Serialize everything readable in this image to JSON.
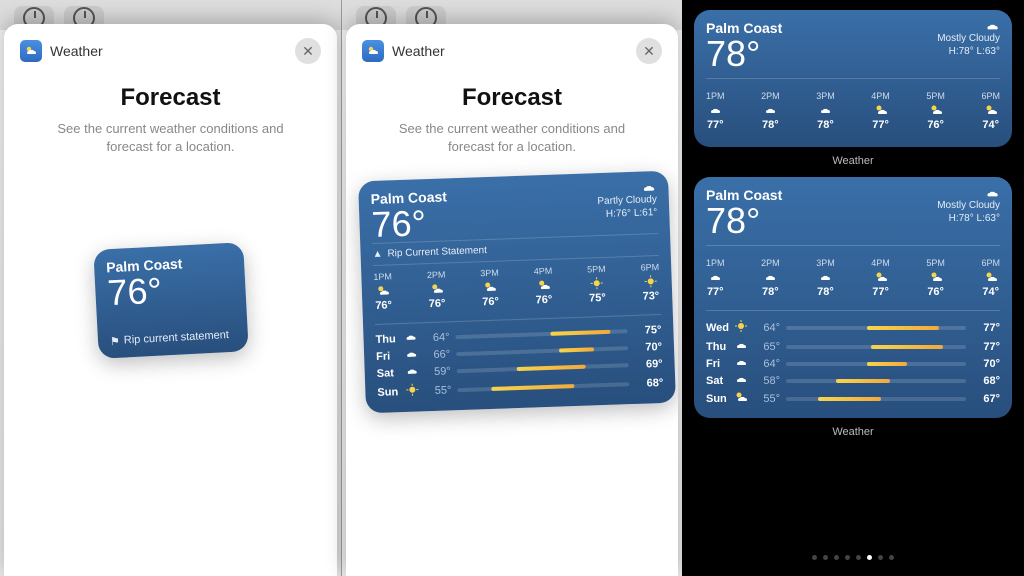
{
  "panels": {
    "p1": {
      "app_name": "Weather",
      "title": "Forecast",
      "subtitle": "See the current weather conditions and forecast for a location.",
      "widget": {
        "city": "Palm Coast",
        "temp": "76°",
        "alert_icon": "⚑",
        "alert": "Rip current statement"
      }
    },
    "p2": {
      "app_name": "Weather",
      "title": "Forecast",
      "subtitle": "See the current weather conditions and forecast for a location.",
      "widget": {
        "city": "Palm Coast",
        "temp": "76°",
        "cond": "Partly Cloudy",
        "hilo": "H:76° L:61°",
        "alert": "Rip Current Statement",
        "hourly": [
          {
            "t": "1PM",
            "icon": "pc",
            "v": "76°"
          },
          {
            "t": "2PM",
            "icon": "pc",
            "v": "76°"
          },
          {
            "t": "3PM",
            "icon": "pc",
            "v": "76°"
          },
          {
            "t": "4PM",
            "icon": "pc",
            "v": "76°"
          },
          {
            "t": "5PM",
            "icon": "sun",
            "v": "75°"
          },
          {
            "t": "6PM",
            "icon": "sun",
            "v": "73°"
          }
        ],
        "daily": [
          {
            "d": "Thu",
            "icon": "cloud",
            "lo": "64°",
            "hi": "75°",
            "bs": 55,
            "bw": 35
          },
          {
            "d": "Fri",
            "icon": "cloud",
            "lo": "66°",
            "hi": "70°",
            "bs": 60,
            "bw": 20
          },
          {
            "d": "Sat",
            "icon": "cloud",
            "lo": "59°",
            "hi": "69°",
            "bs": 35,
            "bw": 40
          },
          {
            "d": "Sun",
            "icon": "sun",
            "lo": "55°",
            "hi": "68°",
            "bs": 20,
            "bw": 48
          }
        ]
      }
    },
    "p3": {
      "caption": "Weather",
      "widget_med": {
        "city": "Palm Coast",
        "temp": "78°",
        "cond": "Mostly Cloudy",
        "hilo": "H:78° L:63°",
        "hourly": [
          {
            "t": "1PM",
            "icon": "cloud",
            "v": "77°"
          },
          {
            "t": "2PM",
            "icon": "cloud",
            "v": "78°"
          },
          {
            "t": "3PM",
            "icon": "cloud",
            "v": "78°"
          },
          {
            "t": "4PM",
            "icon": "pc",
            "v": "77°"
          },
          {
            "t": "5PM",
            "icon": "pc",
            "v": "76°"
          },
          {
            "t": "6PM",
            "icon": "pc",
            "v": "74°"
          }
        ]
      },
      "widget_large": {
        "city": "Palm Coast",
        "temp": "78°",
        "cond": "Mostly Cloudy",
        "hilo": "H:78° L:63°",
        "hourly": [
          {
            "t": "1PM",
            "icon": "cloud",
            "v": "77°"
          },
          {
            "t": "2PM",
            "icon": "cloud",
            "v": "78°"
          },
          {
            "t": "3PM",
            "icon": "cloud",
            "v": "78°"
          },
          {
            "t": "4PM",
            "icon": "pc",
            "v": "77°"
          },
          {
            "t": "5PM",
            "icon": "pc",
            "v": "76°"
          },
          {
            "t": "6PM",
            "icon": "pc",
            "v": "74°"
          }
        ],
        "daily": [
          {
            "d": "Wed",
            "icon": "sun",
            "lo": "64°",
            "hi": "77°",
            "bs": 45,
            "bw": 40
          },
          {
            "d": "Thu",
            "icon": "cloud",
            "lo": "65°",
            "hi": "77°",
            "bs": 47,
            "bw": 40
          },
          {
            "d": "Fri",
            "icon": "cloud",
            "lo": "64°",
            "hi": "70°",
            "bs": 45,
            "bw": 22
          },
          {
            "d": "Sat",
            "icon": "cloud",
            "lo": "58°",
            "hi": "68°",
            "bs": 28,
            "bw": 30
          },
          {
            "d": "Sun",
            "icon": "pc",
            "lo": "55°",
            "hi": "67°",
            "bs": 18,
            "bw": 35
          }
        ]
      }
    }
  }
}
